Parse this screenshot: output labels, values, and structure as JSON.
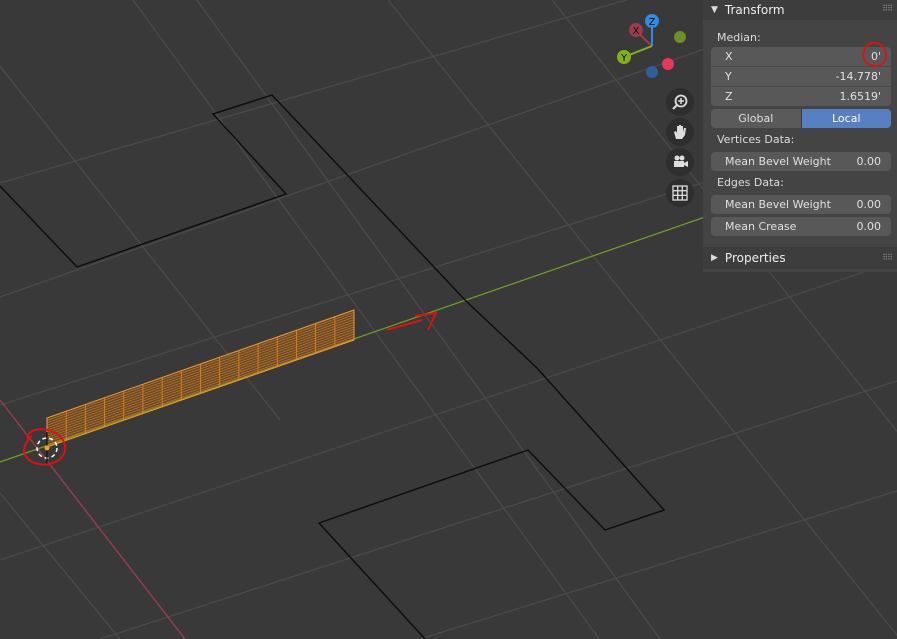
{
  "sidebar": {
    "transform": {
      "title": "Transform",
      "median_label": "Median:",
      "fields": [
        {
          "label": "X",
          "value": "0'"
        },
        {
          "label": "Y",
          "value": "-14.778'"
        },
        {
          "label": "Z",
          "value": "1.6519'"
        }
      ],
      "space_options": [
        {
          "label": "Global",
          "active": false
        },
        {
          "label": "Local",
          "active": true
        }
      ],
      "vertices_label": "Vertices Data:",
      "vertices_fields": [
        {
          "label": "Mean Bevel Weight",
          "value": "0.00"
        }
      ],
      "edges_label": "Edges Data:",
      "edges_fields": [
        {
          "label": "Mean Bevel Weight",
          "value": "0.00"
        },
        {
          "label": "Mean Crease",
          "value": "0.00"
        }
      ]
    },
    "properties": {
      "title": "Properties"
    }
  },
  "gizmo": {
    "axes": [
      {
        "label": "X",
        "color": "#9c3b4b"
      },
      {
        "label": "Y",
        "color": "#7fb31e"
      },
      {
        "label": "Z",
        "color": "#2f8ce6"
      }
    ],
    "negative_colors": [
      "#6d8f26",
      "#e8385a",
      "#2e5f9c"
    ]
  },
  "nav_buttons": [
    "zoom-icon",
    "pan-hand-icon",
    "camera-icon",
    "grid-icon"
  ],
  "colors": {
    "background": "#393939",
    "grid": "#4a4a4a",
    "x_axis": "#9c3e52",
    "y_axis": "#6c9b27",
    "selection": "#e8871c",
    "annotation": "#e01010"
  }
}
